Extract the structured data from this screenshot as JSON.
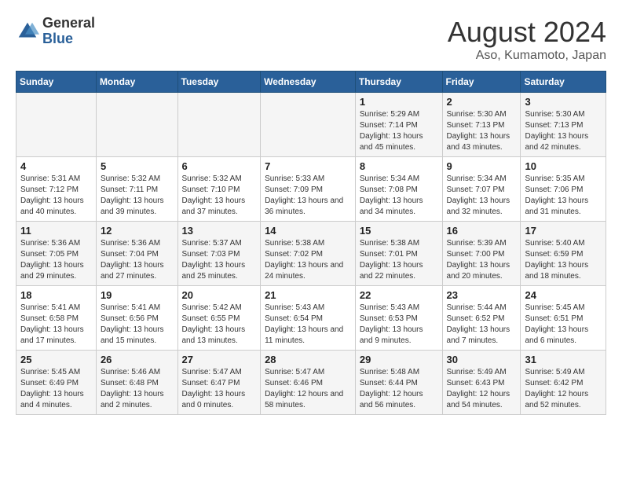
{
  "header": {
    "logo": {
      "general": "General",
      "blue": "Blue"
    },
    "title": "August 2024",
    "subtitle": "Aso, Kumamoto, Japan"
  },
  "weekdays": [
    "Sunday",
    "Monday",
    "Tuesday",
    "Wednesday",
    "Thursday",
    "Friday",
    "Saturday"
  ],
  "weeks": [
    [
      {
        "day": "",
        "info": ""
      },
      {
        "day": "",
        "info": ""
      },
      {
        "day": "",
        "info": ""
      },
      {
        "day": "",
        "info": ""
      },
      {
        "day": "1",
        "info": "Sunrise: 5:29 AM\nSunset: 7:14 PM\nDaylight: 13 hours\nand 45 minutes."
      },
      {
        "day": "2",
        "info": "Sunrise: 5:30 AM\nSunset: 7:13 PM\nDaylight: 13 hours\nand 43 minutes."
      },
      {
        "day": "3",
        "info": "Sunrise: 5:30 AM\nSunset: 7:13 PM\nDaylight: 13 hours\nand 42 minutes."
      }
    ],
    [
      {
        "day": "4",
        "info": "Sunrise: 5:31 AM\nSunset: 7:12 PM\nDaylight: 13 hours\nand 40 minutes."
      },
      {
        "day": "5",
        "info": "Sunrise: 5:32 AM\nSunset: 7:11 PM\nDaylight: 13 hours\nand 39 minutes."
      },
      {
        "day": "6",
        "info": "Sunrise: 5:32 AM\nSunset: 7:10 PM\nDaylight: 13 hours\nand 37 minutes."
      },
      {
        "day": "7",
        "info": "Sunrise: 5:33 AM\nSunset: 7:09 PM\nDaylight: 13 hours\nand 36 minutes."
      },
      {
        "day": "8",
        "info": "Sunrise: 5:34 AM\nSunset: 7:08 PM\nDaylight: 13 hours\nand 34 minutes."
      },
      {
        "day": "9",
        "info": "Sunrise: 5:34 AM\nSunset: 7:07 PM\nDaylight: 13 hours\nand 32 minutes."
      },
      {
        "day": "10",
        "info": "Sunrise: 5:35 AM\nSunset: 7:06 PM\nDaylight: 13 hours\nand 31 minutes."
      }
    ],
    [
      {
        "day": "11",
        "info": "Sunrise: 5:36 AM\nSunset: 7:05 PM\nDaylight: 13 hours\nand 29 minutes."
      },
      {
        "day": "12",
        "info": "Sunrise: 5:36 AM\nSunset: 7:04 PM\nDaylight: 13 hours\nand 27 minutes."
      },
      {
        "day": "13",
        "info": "Sunrise: 5:37 AM\nSunset: 7:03 PM\nDaylight: 13 hours\nand 25 minutes."
      },
      {
        "day": "14",
        "info": "Sunrise: 5:38 AM\nSunset: 7:02 PM\nDaylight: 13 hours\nand 24 minutes."
      },
      {
        "day": "15",
        "info": "Sunrise: 5:38 AM\nSunset: 7:01 PM\nDaylight: 13 hours\nand 22 minutes."
      },
      {
        "day": "16",
        "info": "Sunrise: 5:39 AM\nSunset: 7:00 PM\nDaylight: 13 hours\nand 20 minutes."
      },
      {
        "day": "17",
        "info": "Sunrise: 5:40 AM\nSunset: 6:59 PM\nDaylight: 13 hours\nand 18 minutes."
      }
    ],
    [
      {
        "day": "18",
        "info": "Sunrise: 5:41 AM\nSunset: 6:58 PM\nDaylight: 13 hours\nand 17 minutes."
      },
      {
        "day": "19",
        "info": "Sunrise: 5:41 AM\nSunset: 6:56 PM\nDaylight: 13 hours\nand 15 minutes."
      },
      {
        "day": "20",
        "info": "Sunrise: 5:42 AM\nSunset: 6:55 PM\nDaylight: 13 hours\nand 13 minutes."
      },
      {
        "day": "21",
        "info": "Sunrise: 5:43 AM\nSunset: 6:54 PM\nDaylight: 13 hours\nand 11 minutes."
      },
      {
        "day": "22",
        "info": "Sunrise: 5:43 AM\nSunset: 6:53 PM\nDaylight: 13 hours\nand 9 minutes."
      },
      {
        "day": "23",
        "info": "Sunrise: 5:44 AM\nSunset: 6:52 PM\nDaylight: 13 hours\nand 7 minutes."
      },
      {
        "day": "24",
        "info": "Sunrise: 5:45 AM\nSunset: 6:51 PM\nDaylight: 13 hours\nand 6 minutes."
      }
    ],
    [
      {
        "day": "25",
        "info": "Sunrise: 5:45 AM\nSunset: 6:49 PM\nDaylight: 13 hours\nand 4 minutes."
      },
      {
        "day": "26",
        "info": "Sunrise: 5:46 AM\nSunset: 6:48 PM\nDaylight: 13 hours\nand 2 minutes."
      },
      {
        "day": "27",
        "info": "Sunrise: 5:47 AM\nSunset: 6:47 PM\nDaylight: 13 hours\nand 0 minutes."
      },
      {
        "day": "28",
        "info": "Sunrise: 5:47 AM\nSunset: 6:46 PM\nDaylight: 12 hours\nand 58 minutes."
      },
      {
        "day": "29",
        "info": "Sunrise: 5:48 AM\nSunset: 6:44 PM\nDaylight: 12 hours\nand 56 minutes."
      },
      {
        "day": "30",
        "info": "Sunrise: 5:49 AM\nSunset: 6:43 PM\nDaylight: 12 hours\nand 54 minutes."
      },
      {
        "day": "31",
        "info": "Sunrise: 5:49 AM\nSunset: 6:42 PM\nDaylight: 12 hours\nand 52 minutes."
      }
    ]
  ]
}
